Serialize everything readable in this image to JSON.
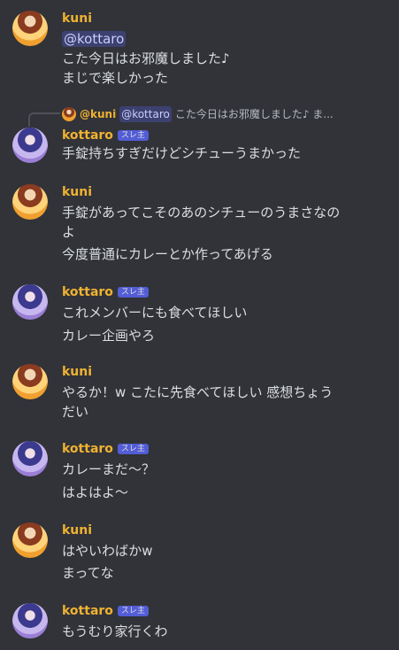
{
  "messages": [
    {
      "author": "kuni",
      "tag": "",
      "mention": "@kottaro",
      "lines": [
        "こた今日はお邪魔しました♪",
        "まじで楽しかった"
      ]
    },
    {
      "author": "kottaro",
      "tag": "スレ主",
      "reply": {
        "author": "@kuni",
        "mention": "@kottaro",
        "text": "こた今日はお邪魔しました♪ ま..."
      },
      "lines": [
        "手錠持ちすぎだけどシチューうまかった"
      ]
    },
    {
      "author": "kuni",
      "tag": "",
      "lines": [
        "手錠があってこそのあのシチューのうまさなの",
        "よ",
        "今度普通にカレーとか作ってあげる"
      ]
    },
    {
      "author": "kottaro",
      "tag": "スレ主",
      "lines": [
        "これメンバーにも食べてほしい",
        "カレー企画やろ"
      ]
    },
    {
      "author": "kuni",
      "tag": "",
      "lines": [
        "やるか！w こたに先食べてほしい 感想ちょう",
        "だい"
      ]
    },
    {
      "author": "kottaro",
      "tag": "スレ主",
      "lines": [
        "カレーまだ～？",
        "はよはよ～"
      ]
    },
    {
      "author": "kuni",
      "tag": "",
      "lines": [
        "はやいわばかw",
        "まってな"
      ]
    },
    {
      "author": "kottaro",
      "tag": "スレ主",
      "lines": [
        "もうむり家行くわ"
      ]
    }
  ],
  "colors": {
    "background": "#313338",
    "author_name": "#f0b232",
    "text": "#dbdee1",
    "mention_bg": "#3c4270",
    "tag_bg": "#5865f2"
  }
}
